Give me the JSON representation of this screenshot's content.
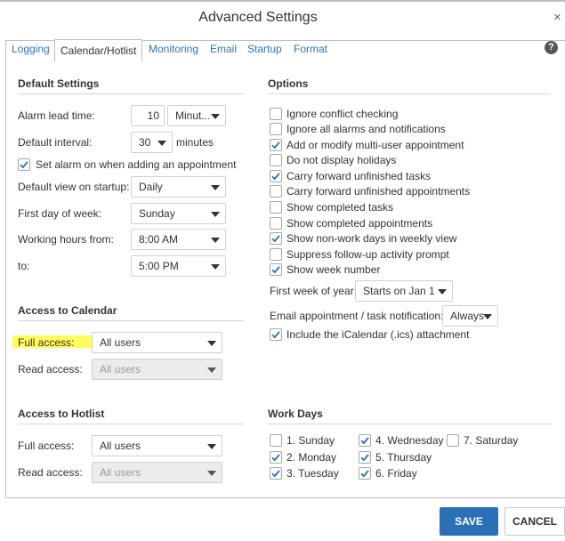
{
  "dialog": {
    "title": "Advanced Settings",
    "close_glyph": "×",
    "help_glyph": "?"
  },
  "tabs": [
    "Logging",
    "Calendar/Hotlist",
    "Monitoring",
    "Email",
    "Startup",
    "Format"
  ],
  "active_tab": "Calendar/Hotlist",
  "default_settings": {
    "heading": "Default Settings",
    "alarm_lead_label": "Alarm lead time:",
    "alarm_lead_value": "10",
    "alarm_lead_unit": "Minut...",
    "interval_label": "Default interval:",
    "interval_value": "30",
    "interval_unit": "minutes",
    "set_alarm_label": "Set alarm on when adding an appointment",
    "set_alarm_checked": true,
    "view_label": "Default view on startup:",
    "view_value": "Daily",
    "first_day_label": "First day of week:",
    "first_day_value": "Sunday",
    "working_from_label": "Working hours from:",
    "working_from_value": "8:00 AM",
    "to_label": "to:",
    "to_value": "5:00 PM"
  },
  "options": {
    "heading": "Options",
    "items": [
      {
        "label": "Ignore conflict checking",
        "checked": false
      },
      {
        "label": "Ignore all alarms and notifications",
        "checked": false
      },
      {
        "label": "Add or modify multi-user appointment",
        "checked": true
      },
      {
        "label": "Do not display holidays",
        "checked": false
      },
      {
        "label": "Carry forward unfinished tasks",
        "checked": true
      },
      {
        "label": "Carry forward unfinished appointments",
        "checked": false
      },
      {
        "label": "Show completed tasks",
        "checked": false
      },
      {
        "label": "Show completed appointments",
        "checked": false
      },
      {
        "label": "Show non-work days in weekly view",
        "checked": true
      },
      {
        "label": "Suppress follow-up activity prompt",
        "checked": false
      },
      {
        "label": "Show week number",
        "checked": true
      }
    ],
    "first_week_label": "First week of year:",
    "first_week_value": "Starts on Jan 1",
    "email_notif_label": "Email appointment / task notification:",
    "email_notif_value": "Always",
    "ical_label": "Include the iCalendar (.ics) attachment",
    "ical_checked": true
  },
  "access_calendar": {
    "heading": "Access to Calendar",
    "full_label": "Full access:",
    "full_value": "All users",
    "read_label": "Read access:",
    "read_value": "All users"
  },
  "access_hotlist": {
    "heading": "Access to Hotlist",
    "full_label": "Full access:",
    "full_value": "All users",
    "read_label": "Read access:",
    "read_value": "All users"
  },
  "work_days": {
    "heading": "Work Days",
    "days": [
      {
        "label": "1. Sunday",
        "checked": false
      },
      {
        "label": "2. Monday",
        "checked": true
      },
      {
        "label": "3. Tuesday",
        "checked": true
      },
      {
        "label": "4. Wednesday",
        "checked": true
      },
      {
        "label": "5. Thursday",
        "checked": true
      },
      {
        "label": "6. Friday",
        "checked": true
      },
      {
        "label": "7. Saturday",
        "checked": false
      }
    ]
  },
  "buttons": {
    "save": "SAVE",
    "cancel": "CANCEL"
  },
  "colors": {
    "link": "#2e75b6",
    "primary": "#2a6fb8",
    "highlight": "#fffc5b",
    "check": "#2a6fb8"
  }
}
